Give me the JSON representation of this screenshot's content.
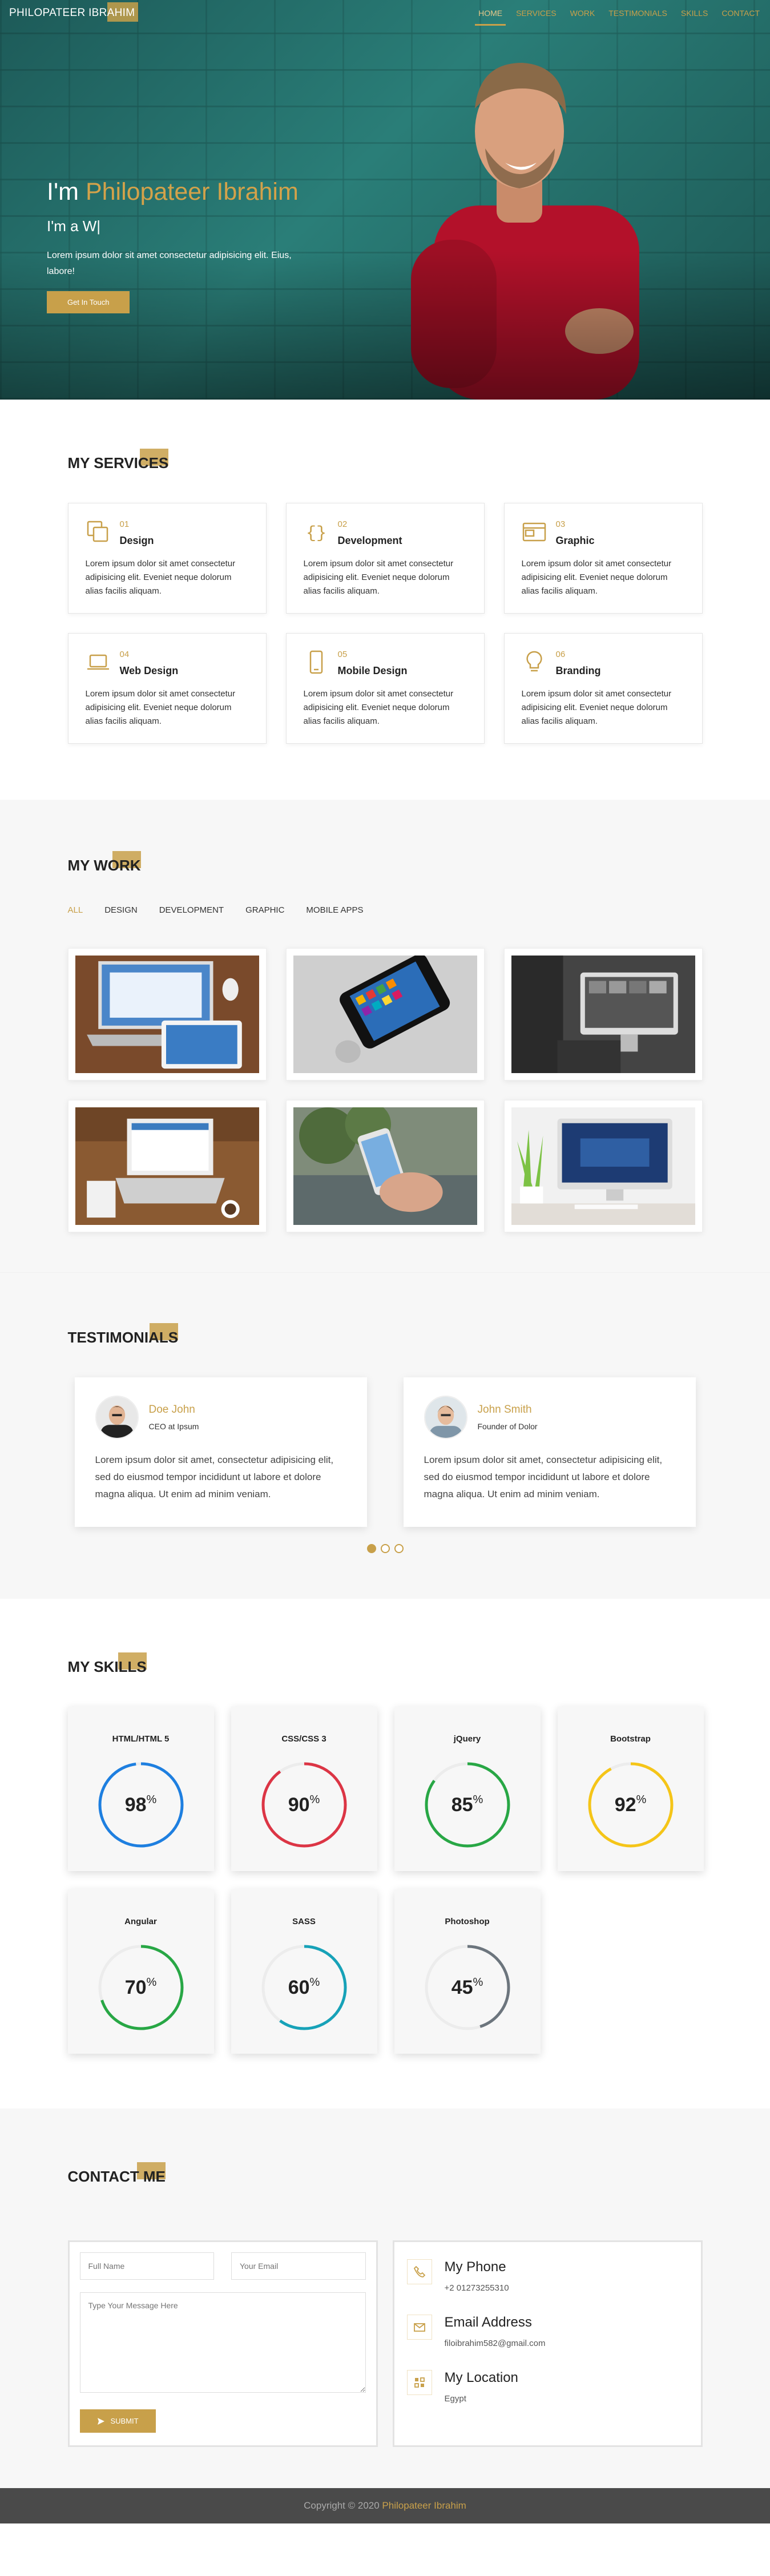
{
  "nav": {
    "logo": "PHILOPATEER IBRAHIM",
    "items": [
      "HOME",
      "SERVICES",
      "WORK",
      "TESTIMONIALS",
      "SKILLS",
      "CONTACT"
    ]
  },
  "hero": {
    "greeting": "I'm",
    "name": "Philopateer Ibrahim",
    "subtitle": "I'm a W|",
    "text": "Lorem ipsum dolor sit amet consectetur adipisicing elit. Eius, labore!",
    "button": "Get In Touch"
  },
  "services": {
    "title": "MY SERVICES",
    "items": [
      {
        "num": "01",
        "name": "Design",
        "icon": "copy-icon",
        "text": "Lorem ipsum dolor sit amet consectetur adipisicing elit. Eveniet neque dolorum alias facilis aliquam."
      },
      {
        "num": "02",
        "name": "Development",
        "icon": "braces-icon",
        "text": "Lorem ipsum dolor sit amet consectetur adipisicing elit. Eveniet neque dolorum alias facilis aliquam."
      },
      {
        "num": "03",
        "name": "Graphic",
        "icon": "window-icon",
        "text": "Lorem ipsum dolor sit amet consectetur adipisicing elit. Eveniet neque dolorum alias facilis aliquam."
      },
      {
        "num": "04",
        "name": "Web Design",
        "icon": "laptop-icon",
        "text": "Lorem ipsum dolor sit amet consectetur adipisicing elit. Eveniet neque dolorum alias facilis aliquam."
      },
      {
        "num": "05",
        "name": "Mobile Design",
        "icon": "mobile-icon",
        "text": "Lorem ipsum dolor sit amet consectetur adipisicing elit. Eveniet neque dolorum alias facilis aliquam."
      },
      {
        "num": "06",
        "name": "Branding",
        "icon": "lightbulb-icon",
        "text": "Lorem ipsum dolor sit amet consectetur adipisicing elit. Eveniet neque dolorum alias facilis aliquam."
      }
    ]
  },
  "work": {
    "title": "MY WORK",
    "filters": [
      "ALL",
      "DESIGN",
      "DEVELOPMENT",
      "GRAPHIC",
      "MOBILE APPS"
    ],
    "active_filter": "ALL",
    "items": [
      "laptop-tablet-photo",
      "iphone-on-table-photo",
      "imac-photo",
      "laptop-desk-photo",
      "phone-in-hand-photo",
      "imac-plant-photo"
    ]
  },
  "testimonials": {
    "title": "TESTIMONIALS",
    "items": [
      {
        "name": "Doe John",
        "role": "CEO at Ipsum",
        "text": "Lorem ipsum dolor sit amet, consectetur adipisicing elit, sed do eiusmod tempor incididunt ut labore et dolore magna aliqua. Ut enim ad minim veniam."
      },
      {
        "name": "John Smith",
        "role": "Founder of Dolor",
        "text": "Lorem ipsum dolor sit amet, consectetur adipisicing elit, sed do eiusmod tempor incididunt ut labore et dolore magna aliqua. Ut enim ad minim veniam."
      }
    ],
    "pages": 3,
    "active_page": 1
  },
  "skills": {
    "title": "MY SKILLS",
    "unit": "%",
    "items": [
      {
        "name": "HTML/HTML 5",
        "value": 98,
        "color": "#1e7fe0"
      },
      {
        "name": "CSS/CSS 3",
        "value": 90,
        "color": "#dc3545"
      },
      {
        "name": "jQuery",
        "value": 85,
        "color": "#28a745"
      },
      {
        "name": "Bootstrap",
        "value": 92,
        "color": "#f5c518"
      },
      {
        "name": "Angular",
        "value": 70,
        "color": "#28a745"
      },
      {
        "name": "SASS",
        "value": 60,
        "color": "#17a2b8"
      },
      {
        "name": "Photoshop",
        "value": 45,
        "color": "#6c757d"
      }
    ]
  },
  "contact": {
    "title": "CONTACT ME",
    "name_placeholder": "Full Name",
    "email_placeholder": "Your Email",
    "message_placeholder": "Type Your Message Here",
    "submit": "SUBMIT",
    "info": [
      {
        "title": "My Phone",
        "detail": "+2 01273255310",
        "icon": "phone-icon"
      },
      {
        "title": "Email Address",
        "detail": "filoibrahim582@gmail.com",
        "icon": "envelope-icon"
      },
      {
        "title": "My Location",
        "detail": "Egypt",
        "icon": "map-icon"
      }
    ]
  },
  "footer": {
    "copyright": "Copyright © 2020",
    "name": "Philopateer Ibrahim"
  },
  "colors": {
    "accent": "#c8a04a",
    "footer": "#4a4a4a"
  }
}
